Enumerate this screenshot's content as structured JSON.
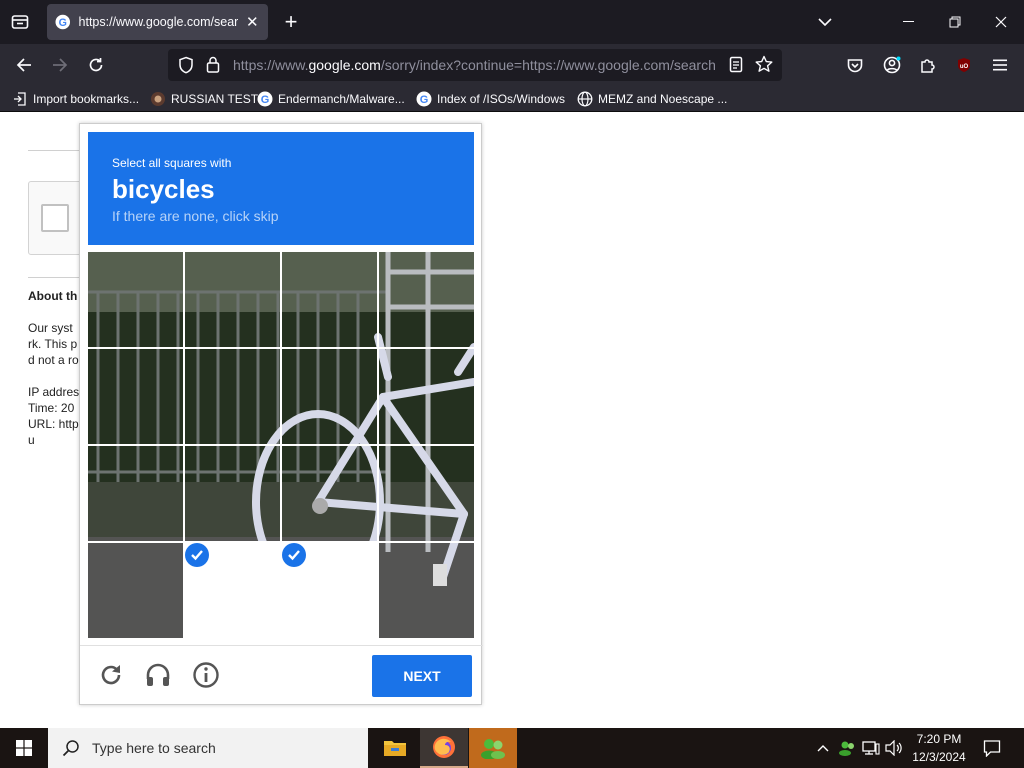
{
  "browser": {
    "tab": {
      "title": "https://www.google.com/search?q=...",
      "close": "✕"
    },
    "newtab": "+",
    "url": {
      "prefix": "https://www.",
      "host": "google.com",
      "rest": "/sorry/index?continue=https://www.google.com/search"
    },
    "bookmarks": [
      {
        "label": "Import bookmarks...",
        "icon": "import-icon"
      },
      {
        "label": "RUSSIAN TEST",
        "icon": "site-icon"
      },
      {
        "label": "Endermanch/Malware...",
        "icon": "google-icon"
      },
      {
        "label": "Index of /ISOs/Windows",
        "icon": "google-icon"
      },
      {
        "label": "MEMZ and Noescape ...",
        "icon": "globe-icon"
      }
    ]
  },
  "page_behind": {
    "about_title": "About th",
    "lines": [
      "Our syst",
      "rk. This p",
      "d not a ro",
      "IP addres",
      "Time: 20",
      "URL: http",
      "u"
    ]
  },
  "captcha": {
    "instruction": "Select all squares with",
    "target": "bicycles",
    "hint": "If there are none, click skip",
    "selected_tiles": [
      13,
      14
    ],
    "next_label": "NEXT",
    "colors": {
      "accent": "#1a73e8"
    }
  },
  "taskbar": {
    "search_placeholder": "Type here to search",
    "time": "7:20 PM",
    "date": "12/3/2024"
  }
}
